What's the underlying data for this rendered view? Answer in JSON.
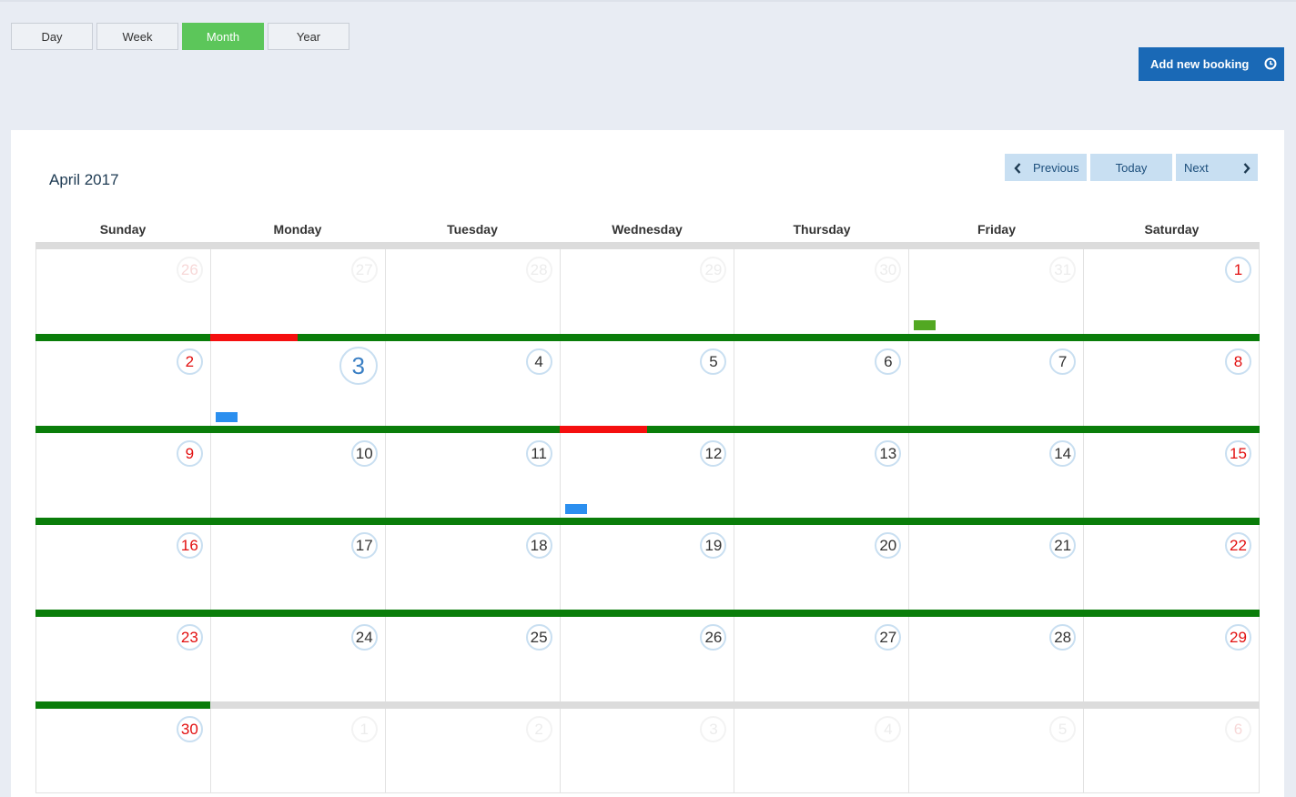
{
  "views": {
    "day": "Day",
    "week": "Week",
    "month": "Month",
    "year": "Year",
    "active": "Month"
  },
  "add_booking_label": "Add new booking",
  "calendar": {
    "title": "April 2017",
    "nav": {
      "previous": "Previous",
      "today": "Today",
      "next": "Next"
    },
    "weekdays": [
      "Sunday",
      "Monday",
      "Tuesday",
      "Wednesday",
      "Thursday",
      "Friday",
      "Saturday"
    ],
    "weeks": [
      {
        "days": [
          {
            "n": "26",
            "other": true,
            "weekend": true
          },
          {
            "n": "27",
            "other": true
          },
          {
            "n": "28",
            "other": true
          },
          {
            "n": "29",
            "other": true
          },
          {
            "n": "30",
            "other": true
          },
          {
            "n": "31",
            "other": true
          },
          {
            "n": "1",
            "weekend": true
          }
        ]
      },
      {
        "days": [
          {
            "n": "2",
            "weekend": true
          },
          {
            "n": "3",
            "today": true
          },
          {
            "n": "4"
          },
          {
            "n": "5"
          },
          {
            "n": "6"
          },
          {
            "n": "7"
          },
          {
            "n": "8",
            "weekend": true
          }
        ]
      },
      {
        "days": [
          {
            "n": "9",
            "weekend": true
          },
          {
            "n": "10"
          },
          {
            "n": "11"
          },
          {
            "n": "12"
          },
          {
            "n": "13"
          },
          {
            "n": "14"
          },
          {
            "n": "15",
            "weekend": true
          }
        ]
      },
      {
        "days": [
          {
            "n": "16",
            "weekend": true
          },
          {
            "n": "17"
          },
          {
            "n": "18"
          },
          {
            "n": "19"
          },
          {
            "n": "20"
          },
          {
            "n": "21"
          },
          {
            "n": "22",
            "weekend": true
          }
        ]
      },
      {
        "days": [
          {
            "n": "23",
            "weekend": true
          },
          {
            "n": "24"
          },
          {
            "n": "25"
          },
          {
            "n": "26"
          },
          {
            "n": "27"
          },
          {
            "n": "28"
          },
          {
            "n": "29",
            "weekend": true
          }
        ]
      },
      {
        "days": [
          {
            "n": "30",
            "weekend": true
          },
          {
            "n": "1",
            "other": true
          },
          {
            "n": "2",
            "other": true
          },
          {
            "n": "3",
            "other": true
          },
          {
            "n": "4",
            "other": true
          },
          {
            "n": "5",
            "other": true
          },
          {
            "n": "6",
            "other": true,
            "weekend": true
          }
        ]
      }
    ]
  },
  "colors": {
    "available": "#0a7d0a",
    "booked": "#f50f0f",
    "empty": "#dcdcdc",
    "accent_green": "#5cc65a",
    "primary_blue": "#1a69b6",
    "marker_blue": "#2b8fef",
    "marker_green": "#52a822"
  }
}
